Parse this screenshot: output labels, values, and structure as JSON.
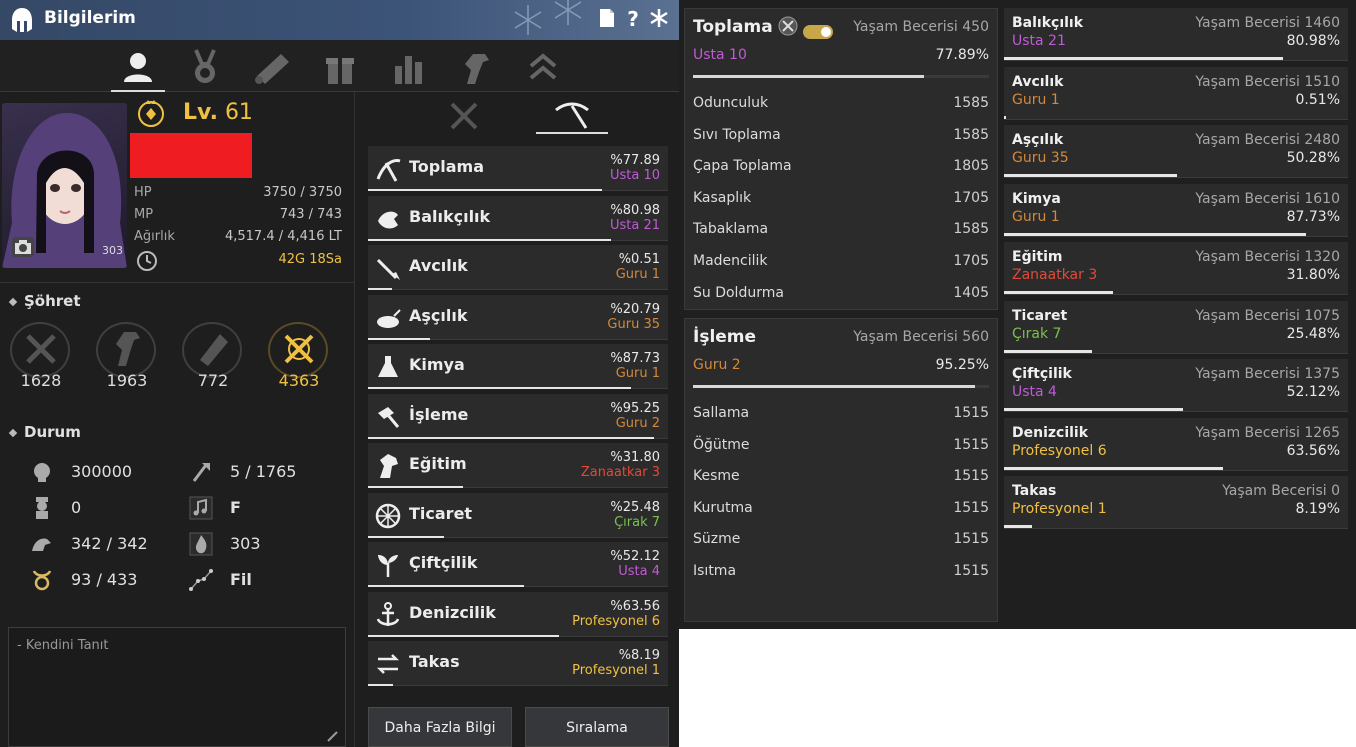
{
  "window": {
    "title": "Bilgilerim"
  },
  "character": {
    "level_label": "Lv.",
    "level": "61",
    "stats": [
      {
        "label": "HP",
        "value": "3750 / 3750"
      },
      {
        "label": "MP",
        "value": "743 / 743"
      },
      {
        "label": "Ağırlık",
        "value": "4,517.4 / 4,416 LT"
      },
      {
        "label": "",
        "value": "42G 18Sa"
      }
    ],
    "portrait_badge": "303"
  },
  "fame": {
    "heading": "Şöhret",
    "items": [
      {
        "value": "1628"
      },
      {
        "value": "1963"
      },
      {
        "value": "772"
      },
      {
        "value": "4363"
      }
    ]
  },
  "durum": {
    "heading": "Durum",
    "left": [
      "300000",
      "0",
      "342 / 342",
      "93 / 433"
    ],
    "right": [
      "5 / 1765",
      "F",
      "303",
      "Fil"
    ]
  },
  "intro": {
    "placeholder": "- Kendini Tanıt"
  },
  "professions": [
    {
      "name": "Toplama",
      "percent": "%77.89",
      "rank": "Usta 10",
      "rank_color": "usta",
      "fill": 0.7789
    },
    {
      "name": "Balıkçılık",
      "percent": "%80.98",
      "rank": "Usta 21",
      "rank_color": "usta",
      "fill": 0.8098
    },
    {
      "name": "Avcılık",
      "percent": "%0.51",
      "rank": "Guru 1",
      "rank_color": "guru",
      "fill": 0.0051
    },
    {
      "name": "Aşçılık",
      "percent": "%20.79",
      "rank": "Guru 35",
      "rank_color": "guru",
      "fill": 0.2079
    },
    {
      "name": "Kimya",
      "percent": "%87.73",
      "rank": "Guru 1",
      "rank_color": "guru",
      "fill": 0.8773
    },
    {
      "name": "İşleme",
      "percent": "%95.25",
      "rank": "Guru 2",
      "rank_color": "guru",
      "fill": 0.9525
    },
    {
      "name": "Eğitim",
      "percent": "%31.80",
      "rank": "Zanaatkar 3",
      "rank_color": "zan",
      "fill": 0.318
    },
    {
      "name": "Ticaret",
      "percent": "%25.48",
      "rank": "Çırak 7",
      "rank_color": "cirak",
      "fill": 0.2548
    },
    {
      "name": "Çiftçilik",
      "percent": "%52.12",
      "rank": "Usta 4",
      "rank_color": "usta",
      "fill": 0.5212
    },
    {
      "name": "Denizcilik",
      "percent": "%63.56",
      "rank": "Profesyonel 6",
      "rank_color": "prof",
      "fill": 0.6356
    },
    {
      "name": "Takas",
      "percent": "%8.19",
      "rank": "Profesyonel 1",
      "rank_color": "prof",
      "fill": 0.0819
    }
  ],
  "buttons": {
    "more_info": "Daha Fazla Bilgi",
    "ranking": "Sıralama"
  },
  "gathering_detail": {
    "title": "Toplama",
    "skill_label": "Yaşam Becerisi 450",
    "rank": "Usta 10",
    "percent": "77.89%",
    "fill": 0.7789,
    "rows": [
      {
        "name": "Odunculuk",
        "value": "1585"
      },
      {
        "name": "Sıvı Toplama",
        "value": "1585"
      },
      {
        "name": "Çapa Toplama",
        "value": "1805"
      },
      {
        "name": "Kasaplık",
        "value": "1705"
      },
      {
        "name": "Tabaklama",
        "value": "1585"
      },
      {
        "name": "Madencilik",
        "value": "1705"
      },
      {
        "name": "Su Doldurma",
        "value": "1405"
      }
    ]
  },
  "processing_detail": {
    "title": "İşleme",
    "skill_label": "Yaşam Becerisi 560",
    "rank": "Guru 2",
    "percent": "95.25%",
    "fill": 0.9525,
    "rows": [
      {
        "name": "Sallama",
        "value": "1515"
      },
      {
        "name": "Öğütme",
        "value": "1515"
      },
      {
        "name": "Kesme",
        "value": "1515"
      },
      {
        "name": "Kurutma",
        "value": "1515"
      },
      {
        "name": "Süzme",
        "value": "1515"
      },
      {
        "name": "Isıtma",
        "value": "1515"
      }
    ]
  },
  "skill_cards": [
    {
      "name": "Balıkçılık",
      "skill": "Yaşam Becerisi 1460",
      "rank": "Usta 21",
      "rank_color": "usta",
      "percent": "80.98%",
      "fill": 0.8098
    },
    {
      "name": "Avcılık",
      "skill": "Yaşam Becerisi 1510",
      "rank": "Guru 1",
      "rank_color": "guru",
      "percent": "0.51%",
      "fill": 0.0051
    },
    {
      "name": "Aşçılık",
      "skill": "Yaşam Becerisi 2480",
      "rank": "Guru 35",
      "rank_color": "guru",
      "percent": "50.28%",
      "fill": 0.5028
    },
    {
      "name": "Kimya",
      "skill": "Yaşam Becerisi 1610",
      "rank": "Guru 1",
      "rank_color": "guru",
      "percent": "87.73%",
      "fill": 0.8773
    },
    {
      "name": "Eğitim",
      "skill": "Yaşam Becerisi 1320",
      "rank": "Zanaatkar 3",
      "rank_color": "zan",
      "percent": "31.80%",
      "fill": 0.318
    },
    {
      "name": "Ticaret",
      "skill": "Yaşam Becerisi 1075",
      "rank": "Çırak 7",
      "rank_color": "cirak",
      "percent": "25.48%",
      "fill": 0.2548
    },
    {
      "name": "Çiftçilik",
      "skill": "Yaşam Becerisi 1375",
      "rank": "Usta 4",
      "rank_color": "usta",
      "percent": "52.12%",
      "fill": 0.5212
    },
    {
      "name": "Denizcilik",
      "skill": "Yaşam Becerisi 1265",
      "rank": "Profesyonel 6",
      "rank_color": "prof",
      "percent": "63.56%",
      "fill": 0.6356
    },
    {
      "name": "Takas",
      "skill": "Yaşam Becerisi 0",
      "rank": "Profesyonel 1",
      "rank_color": "prof",
      "percent": "8.19%",
      "fill": 0.0819
    }
  ],
  "colors": {
    "accent_gold": "#f0c040",
    "usta": "#c05ad6",
    "guru": "#d4883a",
    "zanaatkar": "#e04a3a",
    "cirak": "#79c24a"
  },
  "icons": [
    "helmet-icon",
    "document-icon",
    "help-icon",
    "settings-icon",
    "profile-icon",
    "medal-icon",
    "scroll-icon",
    "gift-icon",
    "bar-chart-icon",
    "horse-icon",
    "rank-chevron-icon",
    "crossed-swords-icon",
    "pickaxe-icon",
    "camera-icon",
    "clock-icon"
  ]
}
